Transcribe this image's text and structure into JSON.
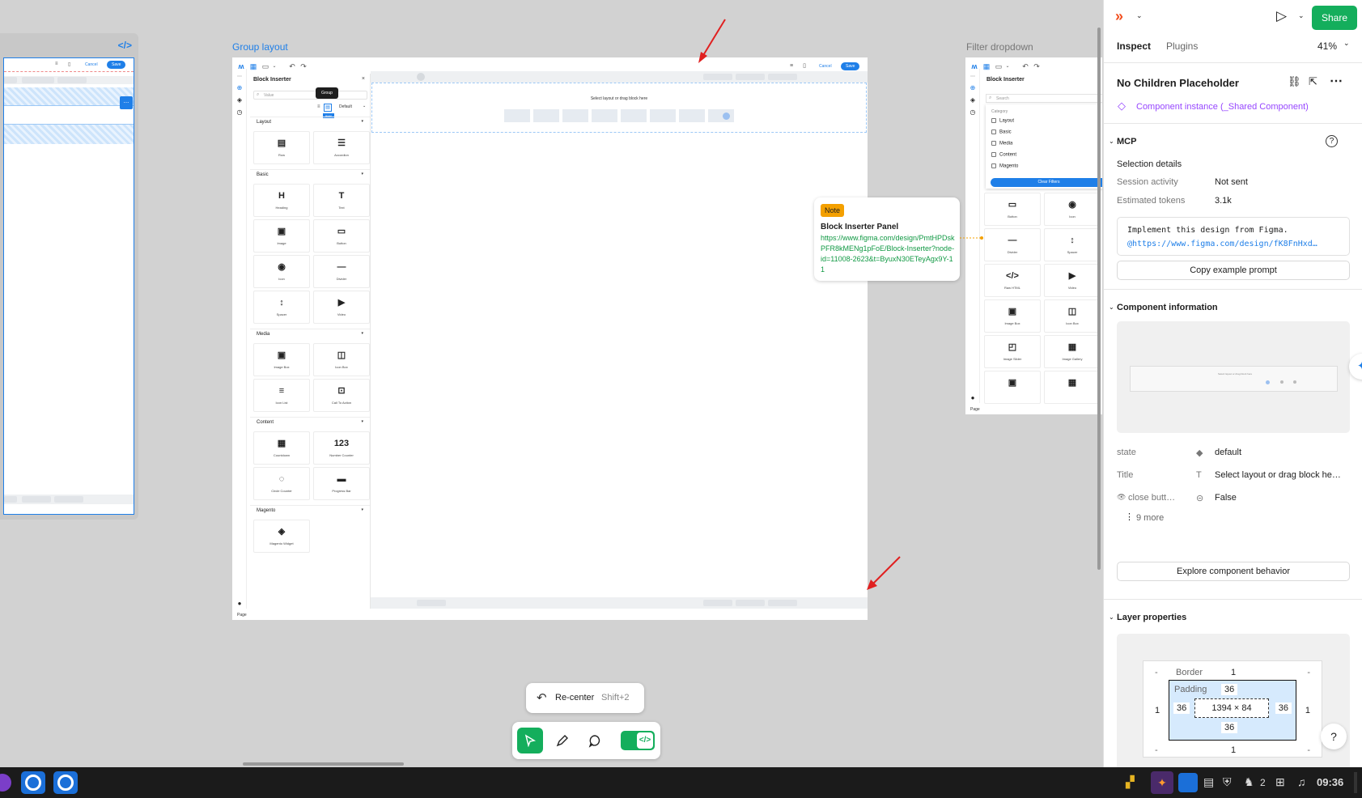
{
  "canvas": {
    "frames": {
      "left_partial": {
        "cancel": "Cancel",
        "save": "Save",
        "dots": "..."
      },
      "group_layout": {
        "label": "Group layout",
        "cancel": "Cancel",
        "save": "Save",
        "panel_title": "Block Inserter",
        "search_placeholder": "Value",
        "tooltip": "Group",
        "dropdown": "Default",
        "badge": "Hover",
        "drop_hint": "Select layout or drag block here",
        "footer": "Page",
        "sections": [
          {
            "title": "Layout",
            "items": [
              {
                "glyph": "▤",
                "label": "Row"
              },
              {
                "glyph": "☰",
                "label": "Accordion"
              }
            ]
          },
          {
            "title": "Basic",
            "items": [
              {
                "glyph": "H",
                "label": "Heading"
              },
              {
                "glyph": "T",
                "label": "Text"
              },
              {
                "glyph": "▣",
                "label": "Image"
              },
              {
                "glyph": "▭",
                "label": "Button"
              },
              {
                "glyph": "◉",
                "label": "Icon"
              },
              {
                "glyph": "—",
                "label": "Divider"
              },
              {
                "glyph": "↕",
                "label": "Spacer"
              },
              {
                "glyph": "▶",
                "label": "Video"
              }
            ]
          },
          {
            "title": "Media",
            "items": [
              {
                "glyph": "▣",
                "label": "Image Box"
              },
              {
                "glyph": "◫",
                "label": "Icon Box"
              },
              {
                "glyph": "≡",
                "label": "Icon List"
              },
              {
                "glyph": "⊡",
                "label": "Call To Action"
              }
            ]
          },
          {
            "title": "Content",
            "items": [
              {
                "glyph": "▦",
                "label": "Countdown"
              },
              {
                "glyph": "123",
                "label": "Number Counter"
              },
              {
                "glyph": "◌",
                "label": "Circle Counter"
              },
              {
                "glyph": "▬",
                "label": "Progress Bar"
              }
            ]
          },
          {
            "title": "Magento",
            "items": [
              {
                "glyph": "◈",
                "label": "Magento Widget"
              }
            ]
          }
        ]
      },
      "filter_dropdown": {
        "label": "Filter dropdown",
        "panel_title": "Block Inserter",
        "search_placeholder": "Search",
        "category_label": "Category",
        "categories": [
          "Layout",
          "Basic",
          "Media",
          "Content",
          "Magento"
        ],
        "clear_filters": "Clear Filters",
        "footer": "Page",
        "items": [
          {
            "glyph": "▭",
            "label": "Button"
          },
          {
            "glyph": "◉",
            "label": "Icon"
          },
          {
            "glyph": "—",
            "label": "Divider"
          },
          {
            "glyph": "↕",
            "label": "Spacer"
          },
          {
            "glyph": "</>",
            "label": "Raw HTML"
          },
          {
            "glyph": "▶",
            "label": "Video"
          },
          {
            "glyph": "▣",
            "label": "Image Box"
          },
          {
            "glyph": "◫",
            "label": "Icon Box"
          },
          {
            "glyph": "◰",
            "label": "Image Slider"
          },
          {
            "glyph": "▦",
            "label": "Image Gallery"
          }
        ]
      }
    },
    "note": {
      "tag": "Note",
      "title": "Block Inserter Panel",
      "link": "https://www.figma.com/design/PmtHPDskPFR8kMENg1pFoE/Block-Inserter?node-id=11008-2623&t=ByuxN30ETeyAgx9Y-11"
    },
    "recenter": {
      "label": "Re-center",
      "shortcut": "Shift+2"
    }
  },
  "right_panel": {
    "share": "Share",
    "tabs": [
      "Inspect",
      "Plugins"
    ],
    "zoom": "41%",
    "component_name": "No Children Placeholder",
    "instance_label": "Component instance (_Shared Component)",
    "mcp": {
      "title": "MCP",
      "selection_details": "Selection details",
      "session_activity_label": "Session activity",
      "session_activity_value": "Not sent",
      "tokens_label": "Estimated tokens",
      "tokens_value": "3.1k",
      "prompt_line1": "Implement this design from Figma.",
      "prompt_line2": "@https://www.figma.com/design/fK8FnHxd…",
      "copy_button": "Copy example prompt"
    },
    "component_info": {
      "title": "Component information",
      "preview_text": "Select layout or drag block here",
      "props": [
        {
          "name": "state",
          "value": "default"
        },
        {
          "name": "Title",
          "value": "Select layout or drag block he…"
        },
        {
          "name": "close butt…",
          "value": "False"
        }
      ],
      "more": "9 more",
      "explore_button": "Explore component behavior"
    },
    "layer_properties": {
      "title": "Layer properties",
      "border_label": "Border",
      "border_top": "1",
      "border_bottom": "1",
      "border_left": "1",
      "border_right": "1",
      "padding_label": "Padding",
      "pad_top": "36",
      "pad_bottom": "36",
      "pad_left": "36",
      "pad_right": "36",
      "size": "1394 × 84",
      "dash": "-",
      "help": "?"
    }
  },
  "taskbar": {
    "notifications_count": "2",
    "time": "09:36"
  },
  "colors": {
    "accent": "#1f7fe8",
    "green": "#14ae5c",
    "purple": "#9747ff",
    "note_tag": "#f4a000",
    "link_green": "#119944"
  }
}
